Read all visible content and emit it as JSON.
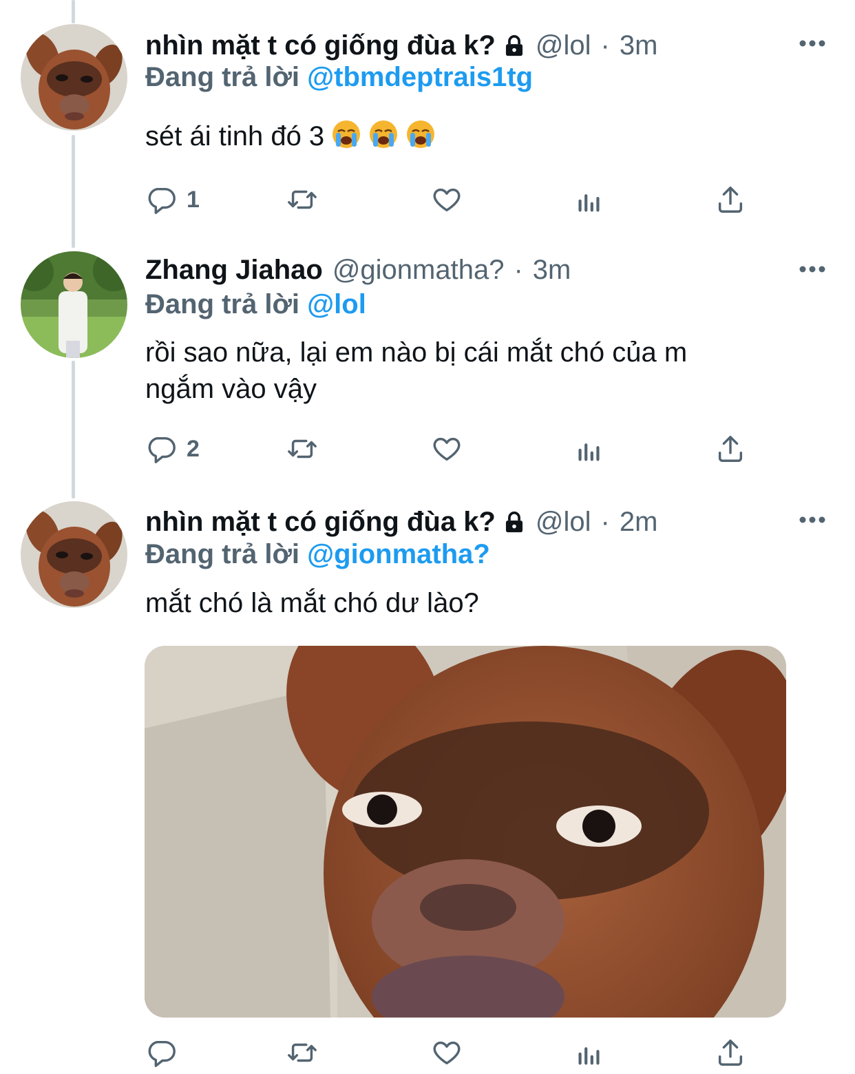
{
  "colors": {
    "accent": "#1d9bf0",
    "secondary_text": "#536471",
    "primary_text": "#0f1419",
    "thread_line": "#cfd9de"
  },
  "tweets": [
    {
      "display_name": "nhìn mặt t có giống đùa k?",
      "protected_icon": "lock-icon",
      "handle": "@lol",
      "separator": "·",
      "time": "3m",
      "replying_prefix": "Đang trả lời",
      "replying_to": "@tbmdeptrais1tg",
      "text": "sét ái tinh đó 3",
      "emojis": [
        "loudly-crying-face",
        "loudly-crying-face",
        "loudly-crying-face"
      ],
      "reply_count": "1"
    },
    {
      "display_name": "Zhang Jiahao",
      "handle": "@gionmatha?",
      "separator": "·",
      "time": "3m",
      "replying_prefix": "Đang trả lời",
      "replying_to": "@lol",
      "text_line1": "rồi sao nữa, lại em nào bị cái mắt chó của m",
      "text_line2": "ngắm vào vậy",
      "reply_count": "2"
    },
    {
      "display_name": "nhìn mặt t có giống đùa k?",
      "protected_icon": "lock-icon",
      "handle": "@lol",
      "separator": "·",
      "time": "2m",
      "replying_prefix": "Đang trả lời",
      "replying_to": "@gionmatha?",
      "text": "mắt chó là mắt chó dư lào?",
      "media": "dog-face-photo"
    }
  ]
}
